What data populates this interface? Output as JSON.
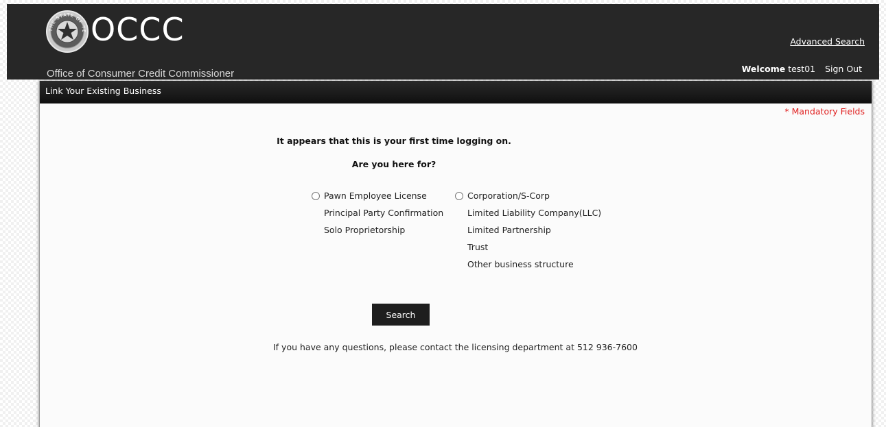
{
  "header": {
    "logo_text": "OCCC",
    "seal_text": "THE STATE OF TEXAS",
    "subtitle": "Office of Consumer Credit Commissioner",
    "advanced_search": "Advanced Search",
    "welcome_label": "Welcome",
    "username": "test01",
    "sign_out": "Sign Out"
  },
  "panel": {
    "title": "Link Your Existing Business",
    "mandatory_note": "* Mandatory Fields",
    "message_first_time": "It appears that this is your first time logging on.",
    "message_question": "Are you here for?",
    "left_option": {
      "label": "Pawn Employee License",
      "items": [
        "Principal Party Confirmation",
        "Solo Proprietorship"
      ]
    },
    "right_option": {
      "label": "Corporation/S-Corp",
      "items": [
        "Limited Liability Company(LLC)",
        "Limited Partnership",
        "Trust",
        "Other business structure"
      ]
    },
    "search_button": "Search",
    "contact_text": "If you have any questions, please contact the licensing department at 512 936-7600"
  },
  "colors": {
    "header_bg": "#272727",
    "mandatory": "#e02020",
    "button_bg": "#1e1e1e"
  }
}
